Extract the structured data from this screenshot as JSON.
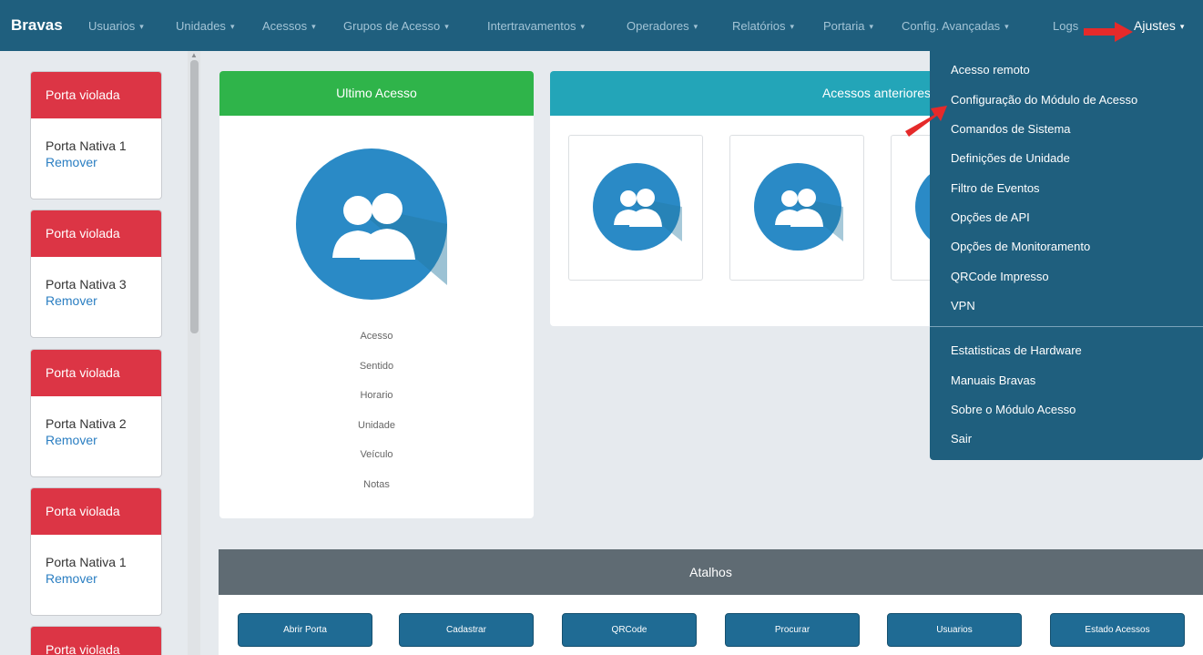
{
  "nav": {
    "brand": "Bravas",
    "items": [
      {
        "label": "Usuarios",
        "caret": "▾"
      },
      {
        "label": "Unidades",
        "caret": "▾"
      },
      {
        "label": "Acessos",
        "caret": "▾"
      },
      {
        "label": "Grupos de Acesso",
        "caret": "▾"
      },
      {
        "label": "Intertravamentos",
        "caret": "▾"
      },
      {
        "label": "Operadores",
        "caret": "▾"
      },
      {
        "label": "Relatórios",
        "caret": "▾"
      },
      {
        "label": "Portaria",
        "caret": "▾"
      },
      {
        "label": "Config. Avançadas",
        "caret": "▾"
      },
      {
        "label": "Logs"
      }
    ],
    "active": {
      "label": "Ajustes",
      "caret": "▾"
    }
  },
  "sidebar": {
    "alerts": [
      {
        "title": "Porta violada",
        "door": "Porta Nativa 1",
        "action": "Remover"
      },
      {
        "title": "Porta violada",
        "door": "Porta Nativa 3",
        "action": "Remover"
      },
      {
        "title": "Porta violada",
        "door": "Porta Nativa 2",
        "action": "Remover"
      },
      {
        "title": "Porta violada",
        "door": "Porta Nativa 1",
        "action": "Remover"
      },
      {
        "title": "Porta violada"
      }
    ]
  },
  "ultimo": {
    "title": "Ultimo Acesso",
    "fields": [
      "Acesso",
      "Sentido",
      "Horario",
      "Unidade",
      "Veículo",
      "Notas"
    ]
  },
  "anteriores": {
    "title": "Acessos anteriores"
  },
  "atalhos": {
    "title": "Atalhos",
    "buttons": [
      "Abrir Porta",
      "Cadastrar",
      "QRCode",
      "Procurar",
      "Usuarios",
      "Estado Acessos"
    ]
  },
  "dropdown": {
    "group1": [
      "Acesso remoto",
      "Configuração do Módulo de Acesso",
      "Comandos de Sistema",
      "Definições de Unidade",
      "Filtro de Eventos",
      "Opções de API",
      "Opções de Monitoramento",
      "QRCode Impresso",
      "VPN"
    ],
    "group2": [
      "Estatisticas de Hardware",
      "Manuais Bravas",
      "Sobre o Módulo Acesso",
      "Sair"
    ]
  },
  "colors": {
    "navbar": "#1f5f7e",
    "danger": "#dc3545",
    "success": "#2fb44a",
    "info": "#23a5b8",
    "avatar": "#2a8ac6",
    "arrow": "#e52a2a"
  },
  "icons": {
    "avatar": "users-icon",
    "annotation": "red-arrow-icon"
  }
}
